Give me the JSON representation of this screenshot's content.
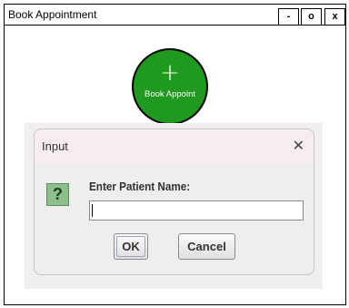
{
  "window": {
    "title": "Book Appointment",
    "minimize_label": "-",
    "maximize_label": "o",
    "close_label": "x"
  },
  "main": {
    "book_button": {
      "icon": "plus-icon",
      "icon_glyph": "+",
      "label": "Book Appoint",
      "color": "#1f9a1f"
    }
  },
  "dialog": {
    "title": "Input",
    "close_glyph": "✕",
    "question_icon_glyph": "?",
    "prompt": "Enter Patient Name:",
    "input_value": "",
    "ok_label": "OK",
    "cancel_label": "Cancel"
  }
}
